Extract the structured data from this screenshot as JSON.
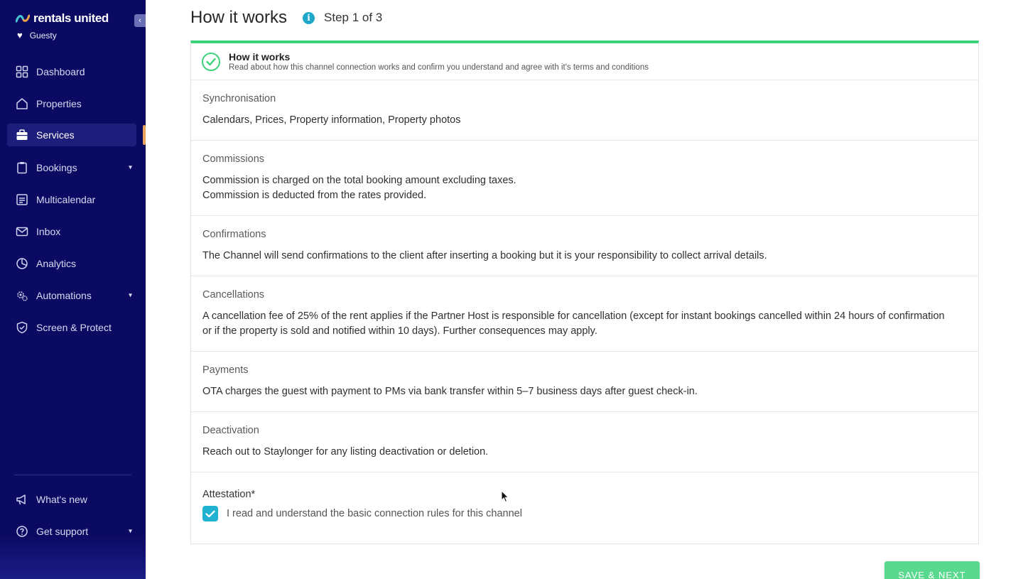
{
  "brand": {
    "name": "rentals united",
    "account": "Guesty"
  },
  "sidebar": {
    "collapse_label": "‹",
    "items": [
      {
        "label": "Dashboard",
        "icon": "dashboard-icon"
      },
      {
        "label": "Properties",
        "icon": "home-icon"
      },
      {
        "label": "Services",
        "icon": "briefcase-icon",
        "active": true
      },
      {
        "label": "Bookings",
        "icon": "clipboard-icon",
        "expandable": true
      },
      {
        "label": "Multicalendar",
        "icon": "calendar-icon"
      },
      {
        "label": "Inbox",
        "icon": "mail-icon"
      },
      {
        "label": "Analytics",
        "icon": "pie-chart-icon"
      },
      {
        "label": "Automations",
        "icon": "gears-icon",
        "expandable": true
      },
      {
        "label": "Screen & Protect",
        "icon": "shield-icon"
      }
    ],
    "bottom_items": [
      {
        "label": "What's new",
        "icon": "megaphone-icon"
      },
      {
        "label": "Get support",
        "icon": "help-circle-icon",
        "expandable": true
      }
    ]
  },
  "header": {
    "title": "How it works",
    "step": "Step 1 of 3"
  },
  "card": {
    "title": "How it works",
    "subtitle": "Read about how this channel connection works and confirm you understand and agree with it's terms and conditions",
    "sections": [
      {
        "title": "Synchronisation",
        "body": [
          "Calendars, Prices, Property information, Property photos"
        ]
      },
      {
        "title": "Commissions",
        "body": [
          "Commission is charged on the total booking amount excluding taxes.",
          "Commission is deducted from the rates provided."
        ]
      },
      {
        "title": "Confirmations",
        "body": [
          "The Channel will send confirmations to the client after inserting a booking but it is your responsibility to collect arrival details."
        ]
      },
      {
        "title": "Cancellations",
        "body": [
          "A cancellation fee of 25% of the rent applies if the Partner Host is responsible for cancellation (except for instant bookings cancelled within 24 hours of confirmation",
          "or if the property is sold and notified within 10 days). Further consequences may apply."
        ]
      },
      {
        "title": "Payments",
        "body": [
          "OTA charges the guest with payment to PMs via bank transfer within 5–7 business days after guest check-in."
        ]
      },
      {
        "title": "Deactivation",
        "body": [
          "Reach out to Staylonger for any listing deactivation or deletion."
        ]
      }
    ],
    "attestation": {
      "title": "Attestation*",
      "label": "I read and understand the basic connection rules for this channel",
      "checked": true
    }
  },
  "actions": {
    "save_next": "SAVE & NEXT"
  },
  "colors": {
    "sidebar_bg": "#0b0a63",
    "accent_green": "#3dd37b",
    "checkbox_blue": "#1fb3d1",
    "info_blue": "#1ea7c8",
    "active_marker": "#e9a25a"
  }
}
